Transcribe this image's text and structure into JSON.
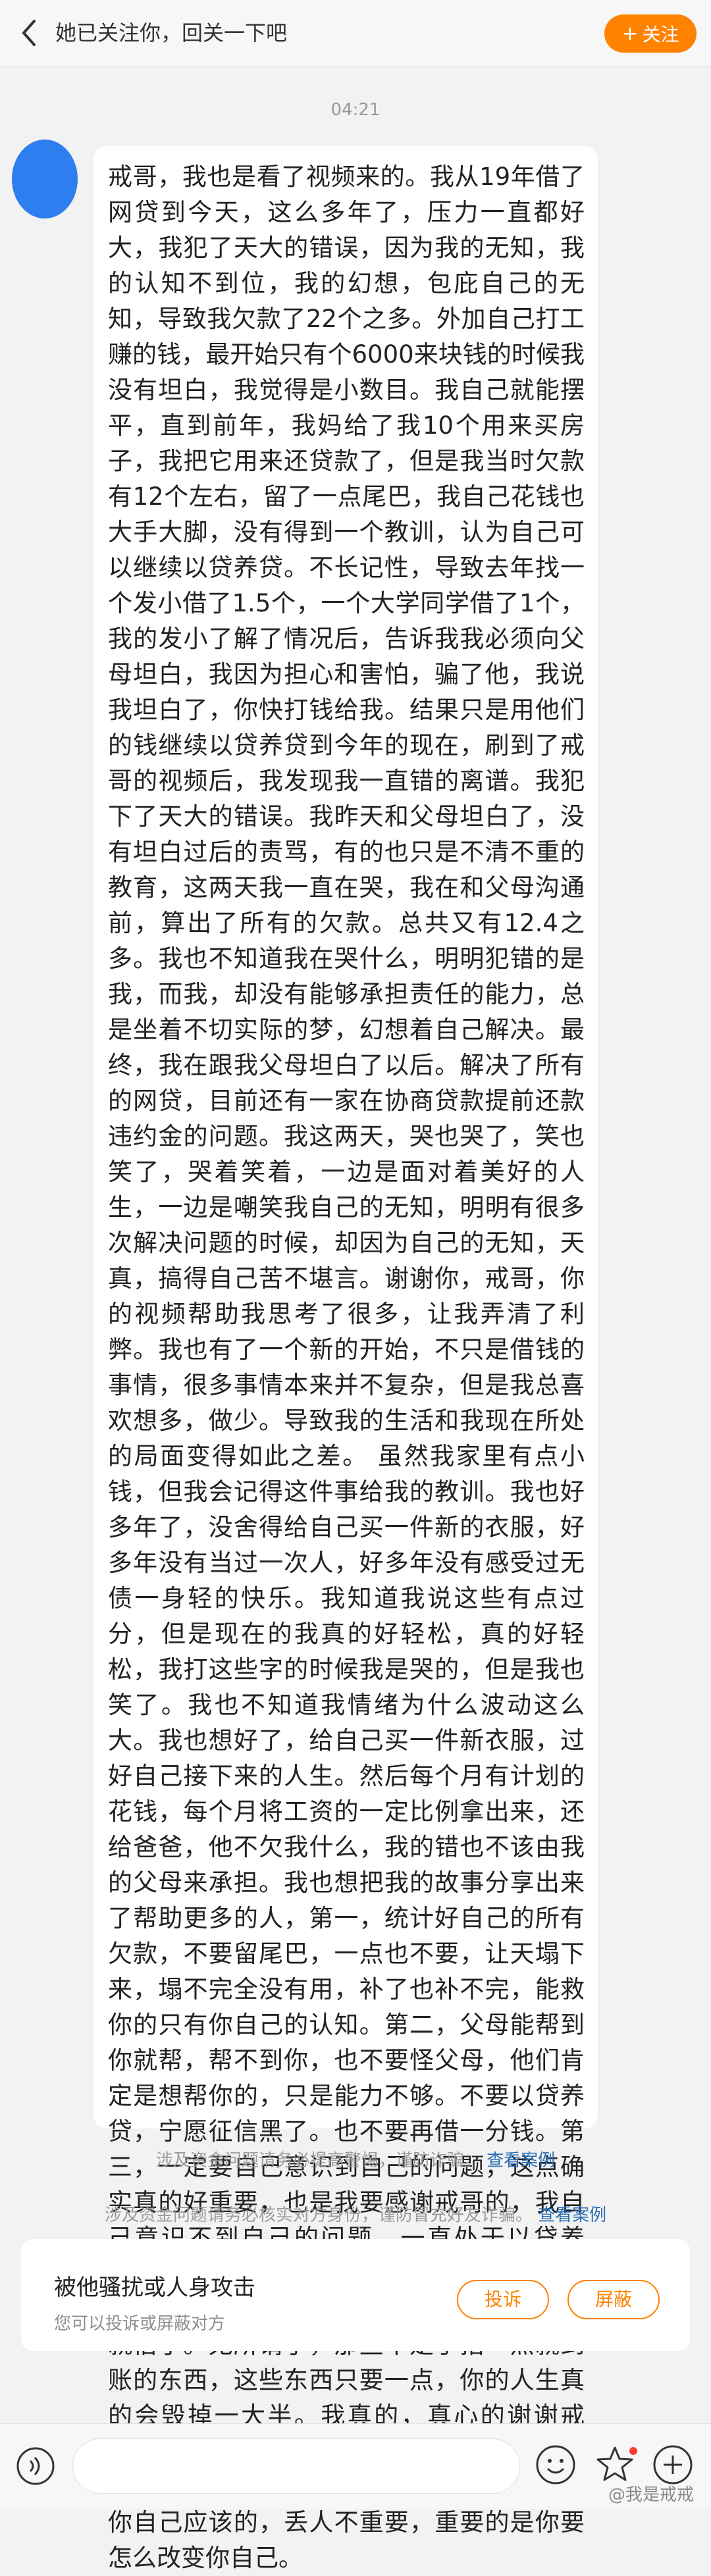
{
  "header": {
    "title": "她已关注你，回关一下吧",
    "follow_label": "关注",
    "follow_plus": "+"
  },
  "chat": {
    "timestamp": "04:21",
    "message": "戒哥，我也是看了视频来的。我从19年借了网贷到今天，这么多年了，压力一直都好大，我犯了天大的错误，因为我的无知，我的认知不到位，我的幻想，包庇自己的无知，导致我欠款了22个之多。外加自己打工赚的钱，最开始只有个6000来块钱的时候我没有坦白，我觉得是小数目。我自己就能摆平，直到前年，我妈给了我10个用来买房子，我把它用来还贷款了，但是我当时欠款有12个左右，留了一点尾巴，我自己花钱也大手大脚，没有得到一个教训，认为自己可以继续以贷养贷。不长记性，导致去年找一个发小借了1.5个，一个大学同学借了1个，我的发小了解了情况后，告诉我我必须向父母坦白，我因为担心和害怕，骗了他，我说我坦白了，你快打钱给我。结果只是用他们的钱继续以贷养贷到今年的现在，刷到了戒哥的视频后，我发现我一直错的离谱。我犯下了天大的错误。我昨天和父母坦白了，没有坦白过后的责骂，有的也只是不清不重的教育，这两天我一直在哭，我在和父母沟通前，算出了所有的欠款。总共又有12.4之多。我也不知道我在哭什么，明明犯错的是我，而我，却没有能够承担责任的能力，总是坐着不切实际的梦，幻想着自己解决。最终，我在跟我父母坦白了以后。解决了所有的网贷，目前还有一家在协商贷款提前还款违约金的问题。我这两天，哭也哭了，笑也笑了，哭着笑着，一边是面对着美好的人生，一边是嘲笑我自己的无知，明明有很多次解决问题的时候，却因为自己的无知，天真，搞得自己苦不堪言。谢谢你，戒哥，你的视频帮助我思考了很多，让我弄清了利弊。我也有了一个新的开始，不只是借钱的事情，很多事情本来并不复杂，但是我总喜欢想多，做少。导致我的生活和我现在所处的局面变得如此之差。 虽然我家里有点小钱，但我会记得这件事给我的教训。我也好多年了，没舍得给自己买一件新的衣服，好多年没有当过一次人，好多年没有感受过无债一身轻的快乐。我知道我说这些有点过分，但是现在的我真的好轻松，真的好轻松，我打这些字的时候我是哭的，但是我也笑了。我也不知道我情绪为什么波动这么大。我也想好了，给自己买一件新衣服，过好自己接下来的人生。然后每个月有计划的花钱，每个月将工资的一定比例拿出来，还给爸爸，他不欠我什么，我的错也不该由我的父母来承担。我也想把我的故事分享出来了帮助更多的人，第一，统计好自己的所有欠款，不要留尾巴，一点也不要，让天塌下来，塌不完全没有用，补了也补不完，能救你的只有你自己的认知。第二，父母能帮到你就帮，帮不到你，也不要怪父母，他们肯定是想帮你的，只是能力不够。不要以贷养贷，宁愿征信黑了。也不要再借一分钱。第三，一定要自己意识到自己的问题，这点确实真的好重要，也是我要感谢戒哥的，我自己意识不到自己的问题，一直处于以贷养贷，幻想，做梦的状态。意识不到自己的问题是最可怕的。我之前都借贷麻木了，借了就借了。无所谓了，那些不是手指一点就到账的东西，这些东西只要一点，你的人生真的会毁掉一大半。我真的，真心的谢谢戒哥。我真的谢谢您。明明有些东西就要大方的承认。错了就是错了，不丢人，丢人也是你自己应该的，丢人不重要，重要的是你要怎么改变你自己。"
  },
  "notices": {
    "notice1_text": "涉及资金问题请务必提高警惕，谨防诈骗。",
    "notice1_link": "查看案例",
    "notice2_text": "涉及资金问题请务必核实对方身份，谨防冒充好友诈骗。",
    "notice2_link": "查看案例"
  },
  "report": {
    "title": "被他骚扰或人身攻击",
    "subtitle": "您可以投诉或屏蔽对方",
    "complain_label": "投诉",
    "block_label": "屏蔽"
  },
  "footer": {
    "watermark": "@我是戒戒"
  },
  "colors": {
    "accent": "#ff8200",
    "link": "#2c6fb6",
    "avatar": "#2f7ef0"
  }
}
